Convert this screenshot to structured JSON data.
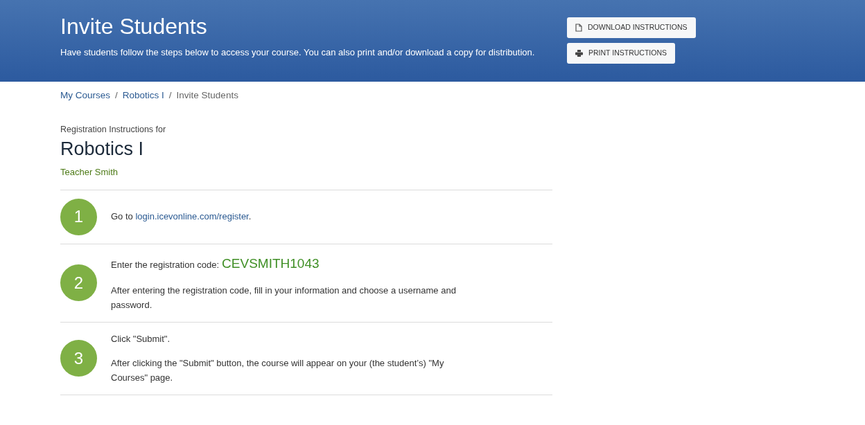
{
  "header": {
    "title": "Invite Students",
    "subtitle": "Have students follow the steps below to access your course. You can also print and/or download a copy for distribution.",
    "buttons": [
      {
        "kind": "download",
        "label": "DOWNLOAD INSTRUCTIONS"
      },
      {
        "kind": "print",
        "label": "PRINT INSTRUCTIONS"
      }
    ]
  },
  "breadcrumb": [
    {
      "label": "My Courses",
      "current": false
    },
    {
      "label": "Robotics I",
      "current": false
    },
    {
      "label": "Invite Students",
      "current": true
    }
  ],
  "breadcrumb_separator": "/",
  "intro": {
    "label": "Registration Instructions for",
    "course": "Robotics I",
    "teacher": "Teacher Smith"
  },
  "steps": [
    {
      "number": "1",
      "text": "Go to ",
      "link": "login.icevonline.com/register",
      "after": "."
    },
    {
      "number": "2",
      "text": "Enter the registration code:",
      "code": "CEVSMITH1043",
      "detail": "After entering the registration code, fill in your information and choose a username and password."
    },
    {
      "number": "3",
      "text": "Click \"Submit\".",
      "detail": "After clicking the \"Submit\" button, the course will appear on your (the student’s) \"My Courses\" page."
    }
  ]
}
